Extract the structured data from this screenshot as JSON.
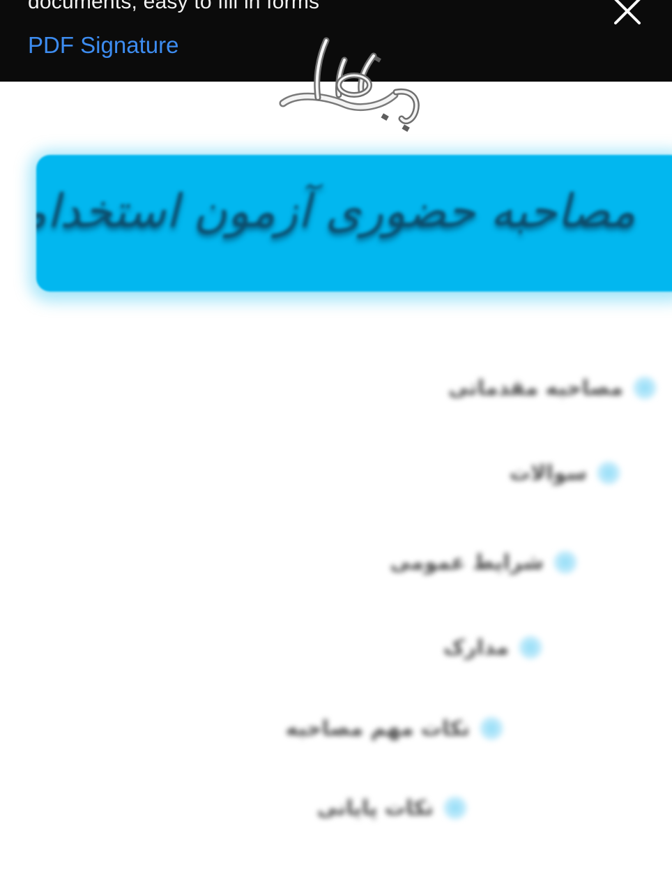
{
  "ad_banner": {
    "text": "documents, easy to fill in forms",
    "link_label": "PDF Signature"
  },
  "logo": {
    "text": "به نام خدا"
  },
  "title_banner": {
    "title": "مصاحبه حضوری آزمون استخدامی"
  },
  "menu": {
    "items": [
      {
        "label": "مصاحبه مقدماتی"
      },
      {
        "label": "سوالات"
      },
      {
        "label": "شرایط عمومی"
      },
      {
        "label": "مدارک"
      },
      {
        "label": "نکات مهم مصاحبه"
      },
      {
        "label": "نکات پایانی"
      }
    ]
  },
  "colors": {
    "banner_background": "#0b0b0b",
    "link": "#3d8cf0",
    "title_banner": "#02b7ef",
    "title_text": "#0d4c6b",
    "icon": "#8fdcf7"
  }
}
